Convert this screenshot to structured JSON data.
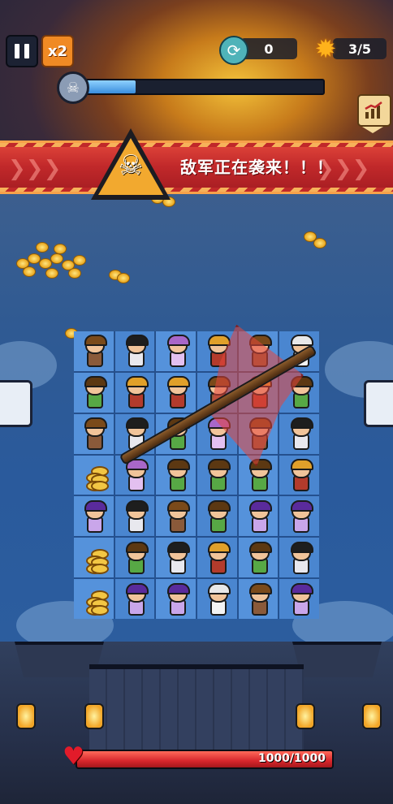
{
  "hud": {
    "speed_label": "x2",
    "refresh_count": "0",
    "stars": "3/5",
    "wave_progress": 0.23,
    "icons": {
      "pause": "pause-icon",
      "refresh": "refresh-icon",
      "star": "star-icon",
      "skull": "skull-icon",
      "stats": "chart-icon"
    }
  },
  "banner": {
    "text": "敌军正在袭来！！！"
  },
  "board": {
    "rows": [
      [
        "warrior",
        "archer",
        "mage",
        "chief",
        "warrior",
        "monk"
      ],
      [
        "ranger",
        "chief",
        "chief",
        "warrior",
        "chief",
        "ranger"
      ],
      [
        "warrior",
        "archer",
        "ranger",
        "mage",
        "warrior",
        "archer"
      ],
      [
        "coins",
        "mage",
        "ranger",
        "ranger",
        "ranger",
        "chief"
      ],
      [
        "witch",
        "archer",
        "warrior",
        "ranger",
        "witch",
        "witch"
      ],
      [
        "coins",
        "ranger",
        "archer",
        "chief",
        "ranger",
        "archer"
      ],
      [
        "coins",
        "witch",
        "witch",
        "monk",
        "warrior",
        "witch"
      ]
    ]
  },
  "base": {
    "hp_label": "1000/1000",
    "hp_fraction": 1.0
  },
  "colors": {
    "banner_red": "#c0282a",
    "accent_orange": "#f08a24",
    "hp_red": "#d7262c",
    "wave_blue": "#3a8edc"
  }
}
